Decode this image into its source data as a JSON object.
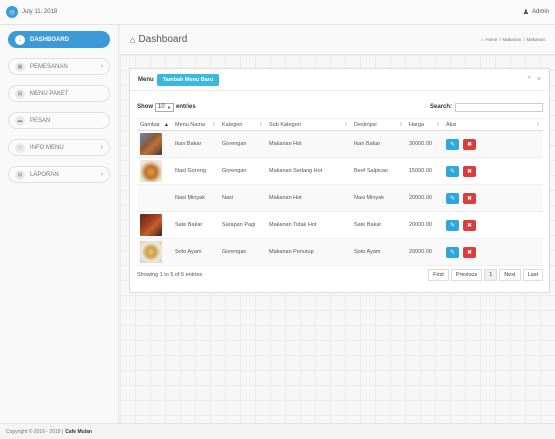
{
  "topbar": {
    "date": "July 11, 2018",
    "user": "Admin"
  },
  "sidebar": {
    "items": [
      {
        "label": "DASHBOARD",
        "active": true
      },
      {
        "label": "PEMESANAN",
        "has_children": true
      },
      {
        "label": "MENU PAKET"
      },
      {
        "label": "PESAN"
      },
      {
        "label": "INFO MENU",
        "has_children": true
      },
      {
        "label": "LAPORAN",
        "has_children": true
      }
    ]
  },
  "page": {
    "title": "Dashboard",
    "breadcrumb": {
      "home": "Home",
      "sep1": "/",
      "middle": "Makanan",
      "sep2": "/",
      "current": "Makanan"
    }
  },
  "panel": {
    "menu_label": "Menu",
    "add_button": "Tambah Menu Baru",
    "collapse_icon": "^",
    "close_icon": "×"
  },
  "table_controls": {
    "show_label": "Show",
    "entries_value": "10",
    "entries_label": "entries",
    "search_label": "Search:",
    "search_value": ""
  },
  "table": {
    "columns": [
      "Gambar",
      "Menu Nama",
      "Kategori",
      "Sub Kategori",
      "Deskripsi",
      "Harga",
      "Aksi"
    ],
    "rows": [
      {
        "nama": "Ikan Bakar",
        "kategori": "Gorengan",
        "sub": "Makanan Hot",
        "deskripsi": "Ikan Bakar",
        "harga": "30000.00",
        "image": "food-image-ikan-bakar"
      },
      {
        "nama": "Nasi Goreng",
        "kategori": "Gorengan",
        "sub": "Makanan Sedang Hot",
        "deskripsi": "Beef Salpicao",
        "harga": "15000.00",
        "image": "food-image-nasi-goreng"
      },
      {
        "nama": "Nasi Minyak",
        "kategori": "Nasi",
        "sub": "Makanan Hot",
        "deskripsi": "Nasi Minyak",
        "harga": "20000.00",
        "image": ""
      },
      {
        "nama": "Sate Bakar",
        "kategori": "Sarapan Pagi",
        "sub": "Makanan Tidak Hot",
        "deskripsi": "Sate Bakar",
        "harga": "20000.00",
        "image": "food-image-sate-bakar"
      },
      {
        "nama": "Soto Ayam",
        "kategori": "Gorengan",
        "sub": "Makanan Penutup",
        "deskripsi": "Soto Ayam",
        "harga": "20000.00",
        "image": "food-image-soto-ayam"
      }
    ]
  },
  "table_footer": {
    "info": "Showing 1 to 5 of 5 entries",
    "pager": {
      "first": "First",
      "previous": "Previous",
      "current": "1",
      "next": "Next",
      "last": "Last"
    }
  },
  "footer": {
    "copyright": "Copyright © 2016 - 2018 |",
    "brand": "Cafe Mulan"
  },
  "colors": {
    "accent": "#3c9ad8",
    "add_button": "#3ab8e0",
    "edit": "#2ea8dc",
    "delete": "#dd3c3c"
  }
}
